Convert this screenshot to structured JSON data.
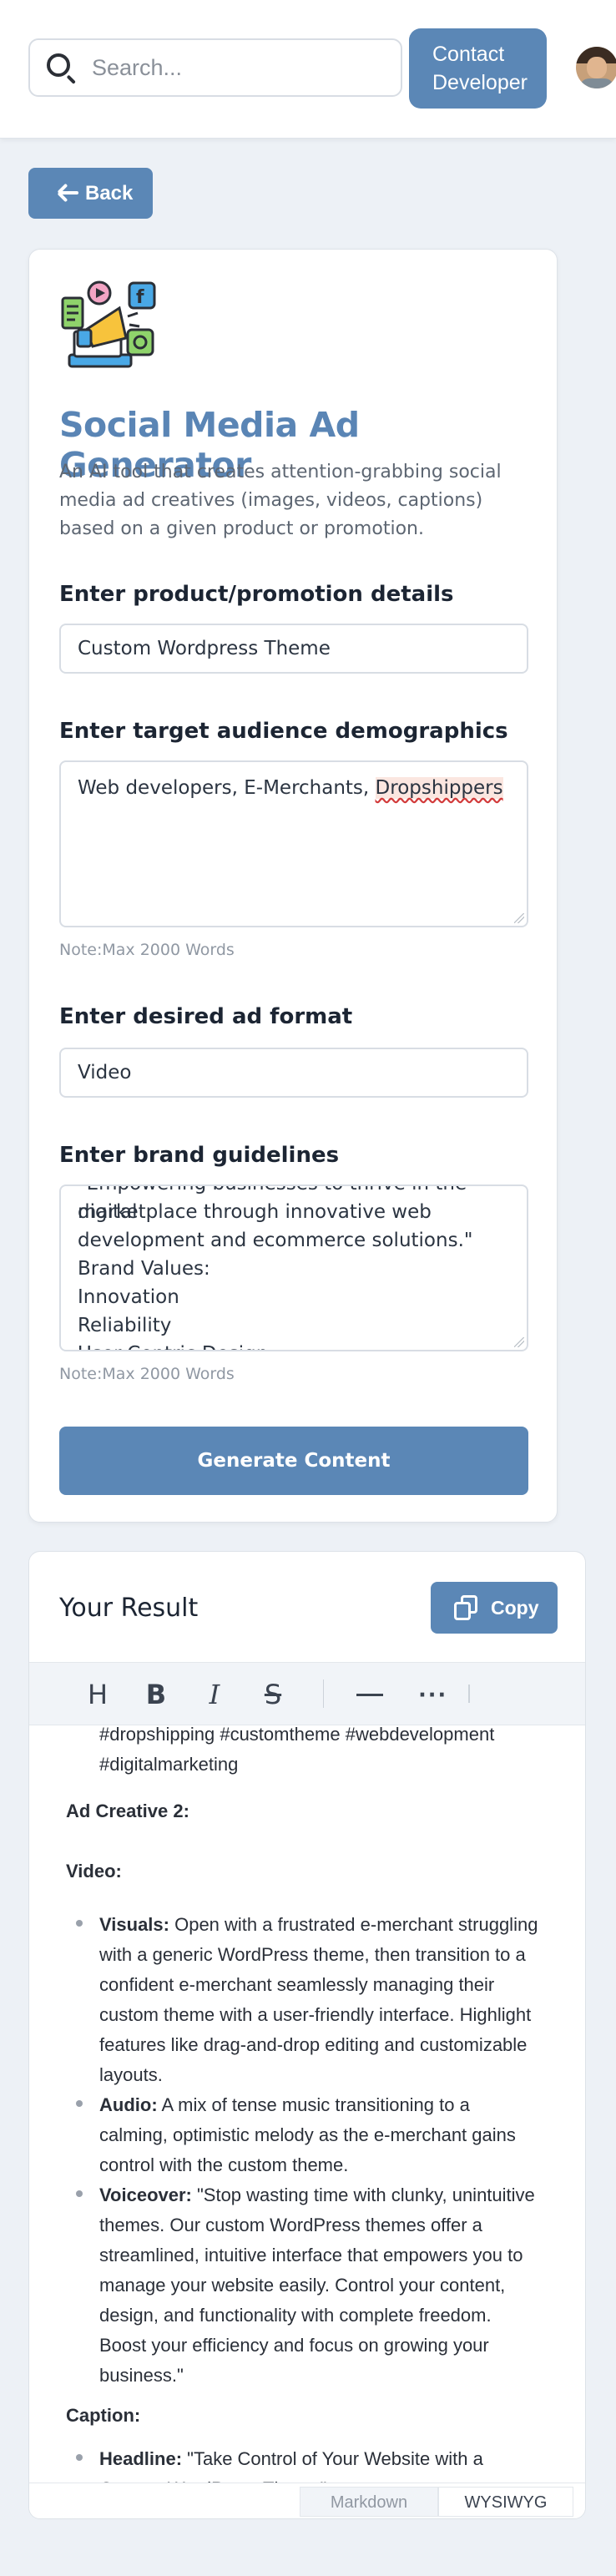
{
  "header": {
    "search_placeholder": "Search...",
    "contact_line1": "Contact",
    "contact_line2": "Developer"
  },
  "nav": {
    "back_label": "Back"
  },
  "tool": {
    "title": "Social Media Ad Generator",
    "description": "An AI tool that creates attention-grabbing social media ad creatives (images, videos, captions) based on a given product or promotion."
  },
  "form": {
    "product_label": "Enter product/promotion details",
    "product_value": "Custom Wordpress Theme",
    "audience_label": "Enter target audience demographics",
    "audience_value_part1": "Web developers, E-Merchants, ",
    "audience_value_part2": "Dropshippers",
    "audience_note": "Note:Max 2000 Words",
    "format_label": "Enter desired ad format",
    "format_value": "Video",
    "brand_label": "Enter brand guidelines",
    "brand_lines": [
      "\"Empowering businesses to thrive in the digital",
      "marketplace through innovative web",
      "development and ecommerce solutions.\"",
      "Brand Values:",
      "Innovation",
      "Reliability",
      "User-Centric Design"
    ],
    "brand_note": "Note:Max 2000 Words",
    "generate_label": "Generate Content"
  },
  "result": {
    "title": "Your Result",
    "copy_label": "Copy",
    "toolbar": {
      "heading": "H",
      "bold": "B",
      "italic": "I",
      "strike": "S",
      "more": "···"
    },
    "content": {
      "hashtags_1": "#dropshipping #customtheme #webdevelopment",
      "hashtags_2": "#digitalmarketing",
      "ad2_heading": "Ad Creative 2:",
      "video_heading": "Video:",
      "visuals_label": "Visuals:",
      "visuals_lines": [
        " Open with a frustrated e-merchant struggling",
        "with a generic WordPress theme, then transition to a",
        "confident e-merchant seamlessly managing their",
        "custom theme with a user-friendly interface.  Highlight",
        "features like drag-and-drop editing and customizable",
        "layouts."
      ],
      "audio_label": "Audio:",
      "audio_lines": [
        "  A mix of tense music transitioning to a",
        "calming, optimistic melody as the e-merchant gains",
        "control with the custom theme."
      ],
      "voiceover_label": "Voiceover:",
      "voiceover_lines": [
        " \"Stop wasting time with clunky, unintuitive",
        "themes.  Our custom WordPress themes offer a",
        "streamlined, intuitive interface that empowers you to",
        "manage your website easily. Control your content,",
        "design, and functionality with complete freedom.",
        "Boost your efficiency and focus on growing your",
        "business.\""
      ],
      "caption_heading": "Caption:",
      "headline_label": "Headline:",
      "headline_lines": [
        " \"Take Control of Your Website with a",
        "Custom WordPress Theme\""
      ]
    },
    "modes": {
      "markdown": "Markdown",
      "wysiwyg": "WYSIWYG"
    }
  },
  "colors": {
    "accent": "#5b87b6",
    "title": "#5a85b5",
    "background": "#edf1f6"
  }
}
